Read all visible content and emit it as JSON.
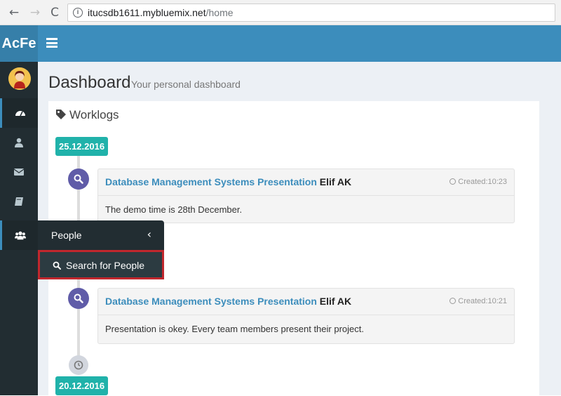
{
  "browser": {
    "nav_back": "←",
    "nav_forward": "→",
    "nav_reload": "C",
    "url_host": "itucsdb1611.mybluemix.net",
    "url_path": "/home"
  },
  "header": {
    "logo": "AcFe",
    "brand_color": "#3c8dbc"
  },
  "sidebar": {
    "items": [
      {
        "icon": "dashboard-icon"
      },
      {
        "icon": "user-icon"
      },
      {
        "icon": "envelope-icon"
      },
      {
        "icon": "book-icon"
      },
      {
        "icon": "users-icon"
      }
    ]
  },
  "flyout": {
    "title": "People",
    "chevron": "‹",
    "sub_item": "Search for People"
  },
  "page": {
    "title": "Dashboard",
    "subtitle": "Your personal dashboard"
  },
  "worklogs": {
    "title": "Worklogs",
    "dates": [
      "25.12.2016",
      "20.12.2016"
    ],
    "items": [
      {
        "title": "Database Management Systems Presentation",
        "author": "Elif AK",
        "time": "Created:10:23",
        "body": "The demo time is 28th December."
      },
      {
        "title": "Database Management Systems Presentation",
        "author": "Elif AK",
        "time": "Created:10:21",
        "body": "Presentation is okey. Every team members present their project."
      }
    ]
  }
}
